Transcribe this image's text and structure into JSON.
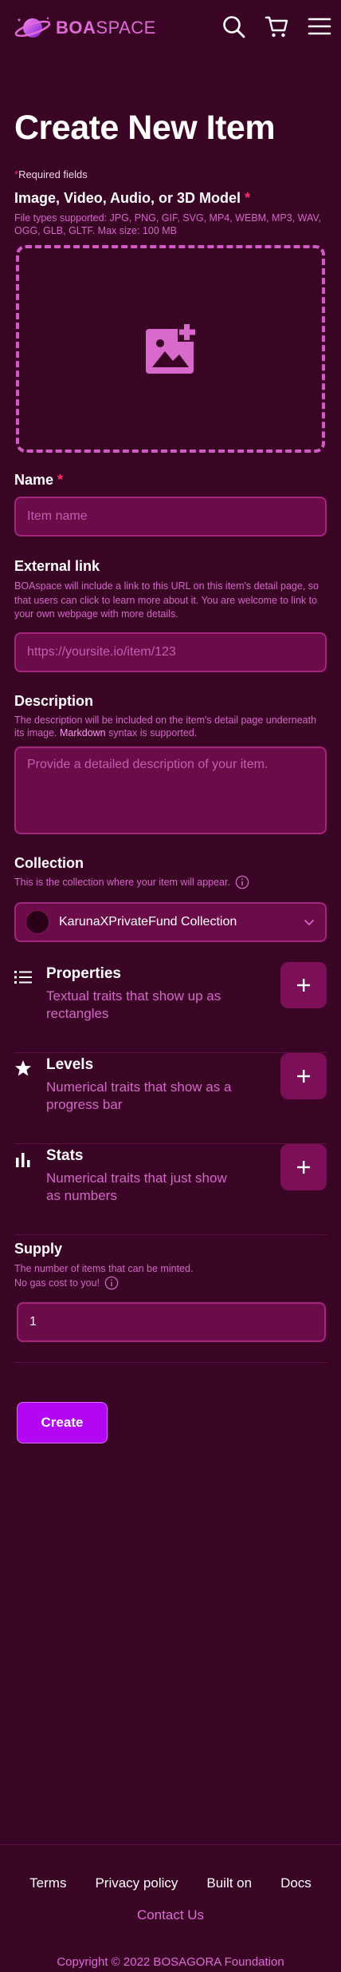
{
  "brand": {
    "name_bold": "BOA",
    "name_light": "SPACE",
    "color": "#e06ad8"
  },
  "header": {
    "icons": [
      "search-icon",
      "cart-icon",
      "menu-icon"
    ]
  },
  "page": {
    "title": "Create New Item",
    "required_note_star": "*",
    "required_note": "Required fields"
  },
  "media": {
    "label": "Image, Video, Audio, or 3D Model",
    "required_star": "*",
    "hint": "File types supported: JPG, PNG, GIF, SVG, MP4, WEBM, MP3, WAV, OGG, GLB, GLTF. Max size: 100 MB",
    "icon": "add-image-icon"
  },
  "name": {
    "label": "Name",
    "required_star": "*",
    "placeholder": "Item name"
  },
  "external_link": {
    "label": "External link",
    "hint": "BOAspace will include a link to this URL on this item's detail page, so that users can click to learn more about it. You are welcome to link to your own webpage with more details.",
    "placeholder": "https://yoursite.io/item/123"
  },
  "description": {
    "label": "Description",
    "hint_before": "The description will be included on the item's detail page underneath its image. ",
    "hint_link": "Markdown",
    "hint_after": " syntax is supported.",
    "placeholder": "Provide a detailed description of your item."
  },
  "collection": {
    "label": "Collection",
    "hint": "This is the collection where your item will appear.",
    "selected": "KarunaXPrivateFund Collection"
  },
  "traits": [
    {
      "title": "Properties",
      "subtitle": "Textual traits that show up as rectangles",
      "icon": "list-icon"
    },
    {
      "title": "Levels",
      "subtitle": "Numerical traits that show as a progress bar",
      "icon": "star-icon"
    },
    {
      "title": "Stats",
      "subtitle": "Numerical traits that just show as numbers",
      "icon": "bar-chart-icon"
    }
  ],
  "supply": {
    "label": "Supply",
    "hint_line1": "The number of items that can be minted.",
    "hint_line2": "No gas cost to you!",
    "value": "1"
  },
  "actions": {
    "create_label": "Create"
  },
  "footer": {
    "links": [
      "Terms",
      "Privacy policy",
      "Built on",
      "Docs"
    ],
    "contact": "Contact Us",
    "copyright": "Copyright © 2022 BOSAGORA Foundation"
  },
  "colors": {
    "background": "#3a0424",
    "field": "#6b0b48",
    "accent": "#b206f5",
    "pink": "#e06ad8",
    "required": "#ff2f63"
  }
}
